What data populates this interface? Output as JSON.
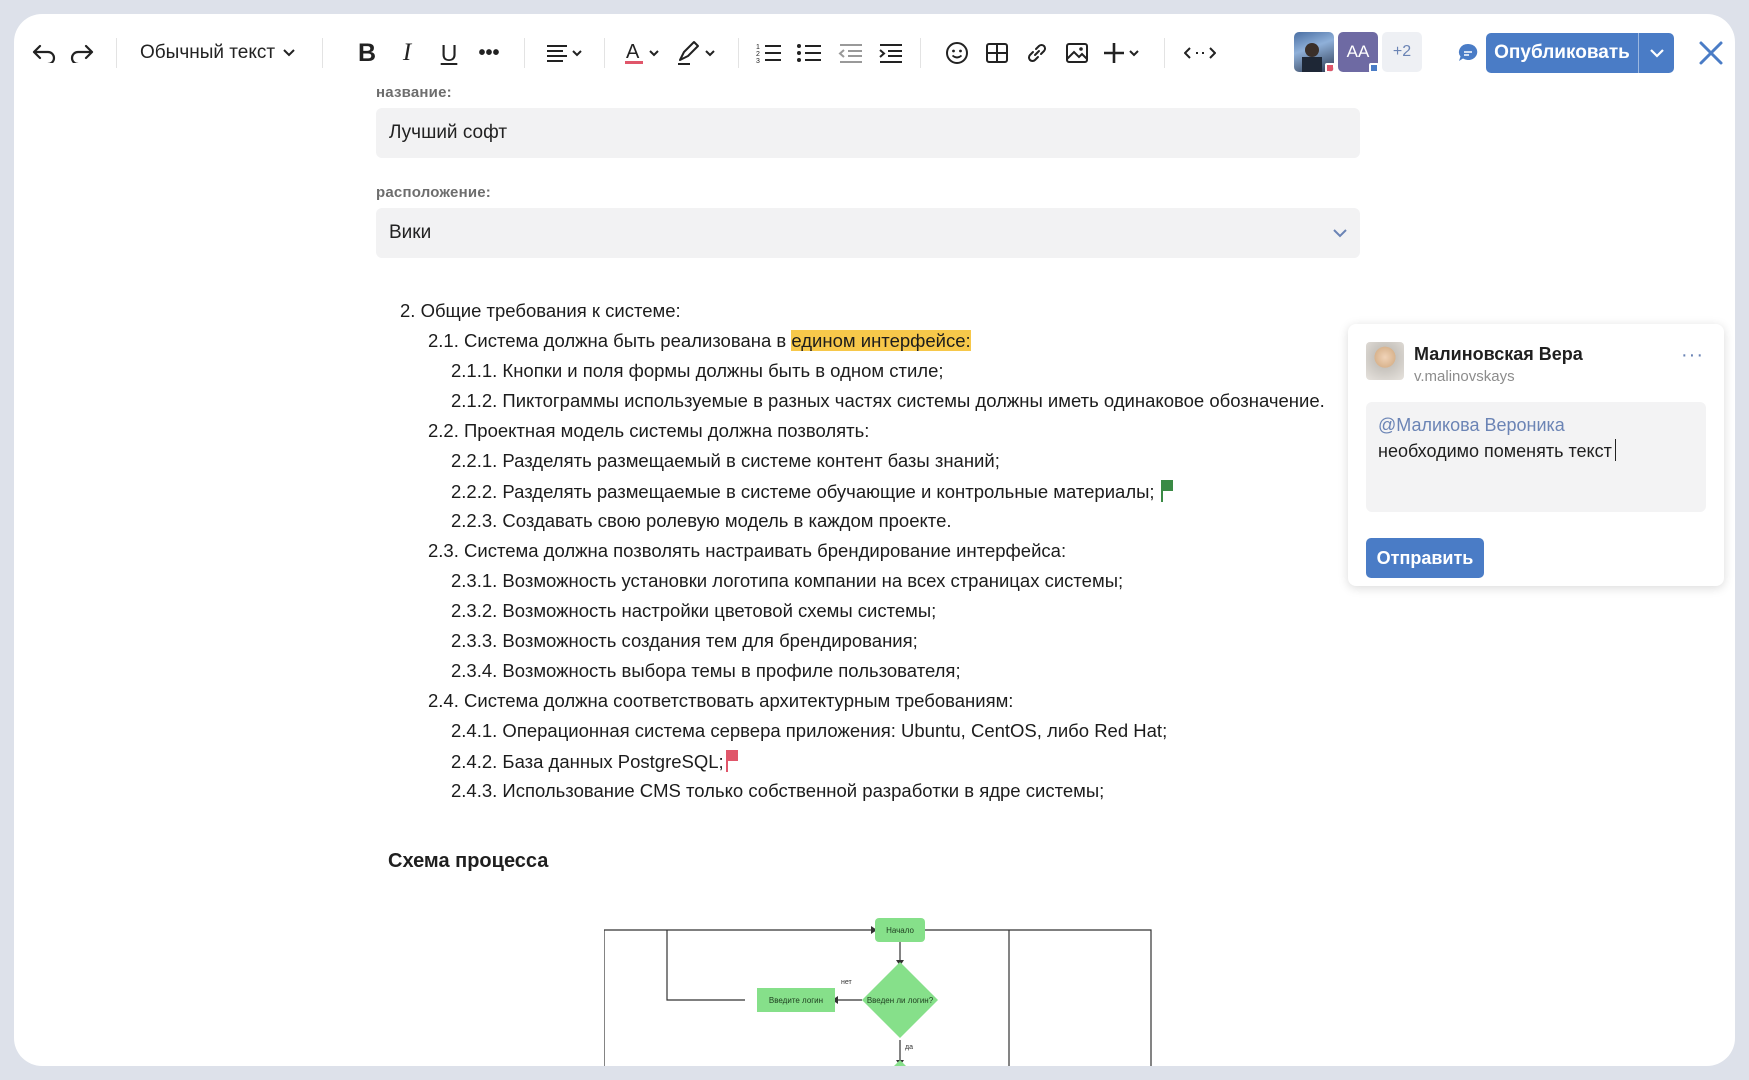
{
  "toolbar": {
    "text_style": "Обычный текст",
    "avatar_initials": "АА",
    "more_users": "+2",
    "publish_label": "Опубликовать"
  },
  "fields": {
    "name_label": "название:",
    "name_value": "Лучший софт",
    "location_label": "расположение:",
    "location_value": "Вики"
  },
  "document": {
    "lines": [
      "2. Общие требования к системе:",
      "2.1. Система должна быть реализована в ",
      "2.1.1. Кнопки и поля формы должны быть в одном стиле;",
      "2.1.2. Пиктограммы используемые в разных частях системы должны иметь одинаковое обозначение.",
      "2.2. Проектная модель системы должна позволять:",
      "2.2.1. Разделять размещаемый в системе контент базы знаний;",
      "2.2.2. Разделять размещаемые в системе обучающие и контрольные материалы;",
      "2.2.3. Создавать свою ролевую модель в каждом проекте.",
      "2.3. Система должна позволять настраивать брендирование интерфейса:",
      "2.3.1. Возможность установки логотипа компании на всех страницах системы;",
      "2.3.2. Возможность настройки цветовой схемы системы;",
      "2.3.3. Возможность создания тем для брендирования;",
      "2.3.4. Возможность выбора темы в профиле пользователя;",
      "2.4. Система должна соответствовать архитектурным требованиям:",
      "2.4.1. Операционная система сервера приложения: Ubuntu, CentOS, либо Red Hat;",
      "2.4.2. База данных PostgreSQL;",
      "2.4.3. Использование CMS только собственной разработки в ядре системы;"
    ],
    "highlight": "едином интерфейсе:",
    "section_title": "Схема процесса"
  },
  "comment": {
    "author": "Малиновская Вера",
    "username": "v.malinovskays",
    "mention": "@Маликова Вероника",
    "text": "необходимо поменять текст",
    "send_label": "Отправить"
  },
  "diagram": {
    "start": "Начало",
    "login_input": "Введите логин",
    "decision": "Введен ли логин?",
    "no": "нет",
    "yes": "да"
  },
  "colors": {
    "accent": "#4a7cc6",
    "highlight": "#f7c84a",
    "flag_green": "#3a8a45",
    "flag_red": "#e0566a",
    "node_green": "#86e08a"
  }
}
